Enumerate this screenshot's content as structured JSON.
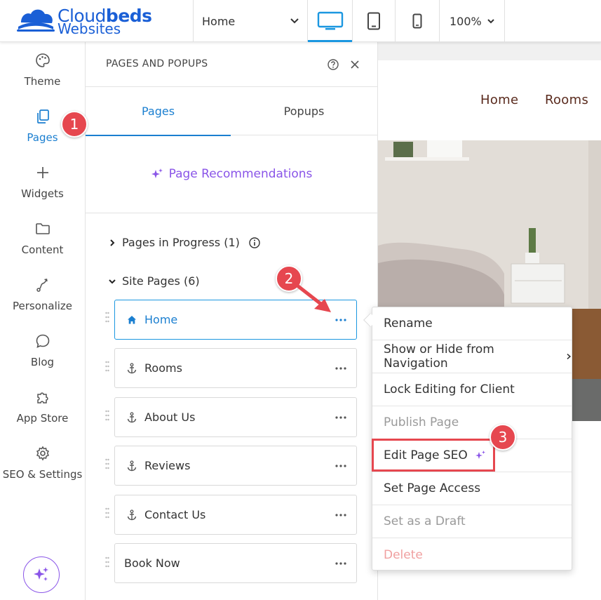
{
  "brand": {
    "word1_regular": "Cloud",
    "word1_bold": "beds",
    "word2": "Websites",
    "color": "#1a5fd6"
  },
  "toolbar": {
    "page_select": "Home",
    "zoom": "100%",
    "devices": [
      "desktop-icon",
      "tablet-icon",
      "mobile-icon"
    ],
    "active_device": "desktop"
  },
  "rail": {
    "items": [
      {
        "label": "Theme",
        "icon": "palette-icon"
      },
      {
        "label": "Pages",
        "icon": "pages-icon"
      },
      {
        "label": "Widgets",
        "icon": "plus-icon"
      },
      {
        "label": "Content",
        "icon": "folder-icon"
      },
      {
        "label": "Personalize",
        "icon": "personalize-icon"
      },
      {
        "label": "Blog",
        "icon": "chat-icon"
      },
      {
        "label": "App Store",
        "icon": "puzzle-icon"
      },
      {
        "label": "SEO & Settings",
        "icon": "gear-icon"
      }
    ],
    "active": "Pages"
  },
  "panel": {
    "title": "PAGES AND POPUPS",
    "tabs": [
      "Pages",
      "Popups"
    ],
    "recommendations": "Page Recommendations",
    "in_progress": "Pages in Progress (1)",
    "site_pages": "Site Pages (6)",
    "pages": [
      {
        "name": "Home",
        "icon": "home-icon"
      },
      {
        "name": "Rooms",
        "icon": "anchor-icon"
      },
      {
        "name": "About Us",
        "icon": "anchor-icon"
      },
      {
        "name": "Reviews",
        "icon": "anchor-icon"
      },
      {
        "name": "Contact Us",
        "icon": "anchor-icon"
      },
      {
        "name": "Book Now",
        "icon": ""
      }
    ]
  },
  "preview": {
    "nav": [
      "Home",
      "Rooms"
    ]
  },
  "context_menu": {
    "items": [
      {
        "label": "Rename",
        "state": "normal"
      },
      {
        "label": "Show or Hide from Navigation",
        "state": "submenu"
      },
      {
        "label": "Lock Editing for Client",
        "state": "normal"
      },
      {
        "label": "Publish Page",
        "state": "disabled"
      },
      {
        "label": "Edit Page SEO",
        "state": "normal"
      },
      {
        "label": "Set Page Access",
        "state": "normal"
      },
      {
        "label": "Set as a Draft",
        "state": "disabled"
      },
      {
        "label": "Delete",
        "state": "danger"
      }
    ]
  },
  "annotations": {
    "step1": "1",
    "step2": "2",
    "step3": "3"
  },
  "colors": {
    "accent": "#1b7fd0",
    "purple": "#8a55e8",
    "annotation": "#e6474f",
    "nav_text": "#5a2b1e"
  }
}
